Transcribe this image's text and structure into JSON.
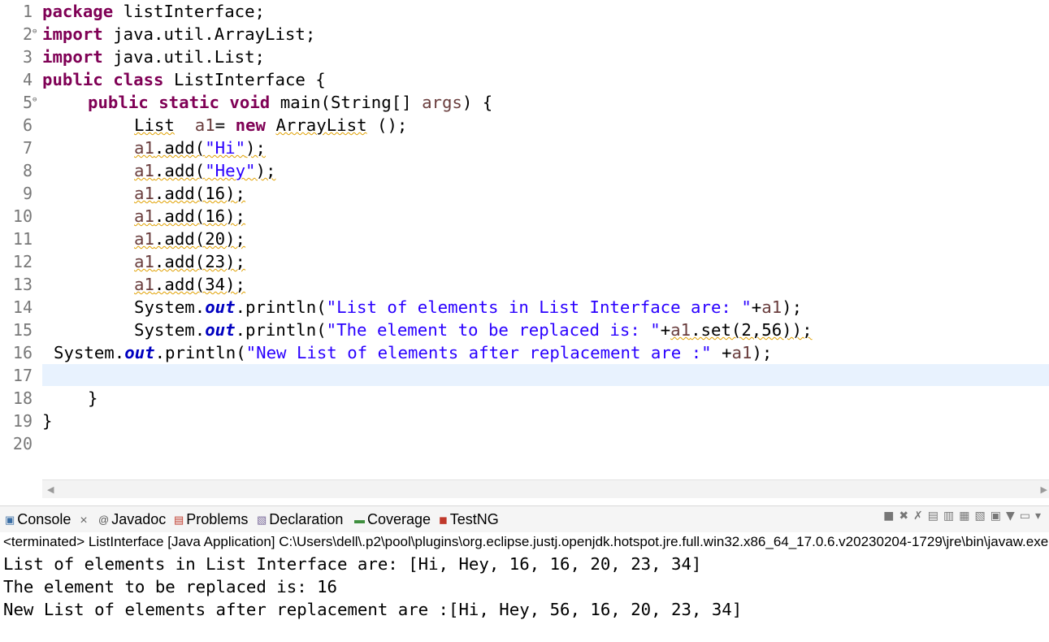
{
  "editor": {
    "line_numbers": [
      "1",
      "2",
      "3",
      "4",
      "5",
      "6",
      "7",
      "8",
      "9",
      "10",
      "11",
      "12",
      "13",
      "14",
      "15",
      "16",
      "17",
      "18",
      "19",
      "20"
    ],
    "code": {
      "l1_kw": "package",
      "l1_rest": " listInterface;",
      "l2_kw": "import",
      "l2_rest": " java.util.ArrayList;",
      "l3_kw": "import",
      "l3_rest": " java.util.List;",
      "l4_kw1": "public",
      "l4_kw2": "class",
      "l4_rest": " ListInterface {",
      "l5_kw1": "public",
      "l5_kw2": "static",
      "l5_kw3": "void",
      "l5_pre": " main(String[] ",
      "l5_var": "args",
      "l5_post": ") {",
      "l6_type": "List",
      "l6_var": "a1",
      "l6_eq": "= ",
      "l6_kw": "new",
      "l6_cls": "ArrayList",
      "l6_post": " ();",
      "l7_var": "a1",
      "l7_call": ".add(",
      "l7_str": "\"Hi\"",
      "l7_end": ");",
      "l8_var": "a1",
      "l8_call": ".add(",
      "l8_str": "\"Hey\"",
      "l8_end": ");",
      "l9_var": "a1",
      "l9_call": ".add(16);",
      "l10_var": "a1",
      "l10_call": ".add(16);",
      "l11_var": "a1",
      "l11_call": ".add(20);",
      "l12_var": "a1",
      "l12_call": ".add(23);",
      "l13_var": "a1",
      "l13_call": ".add(34);",
      "l14_sys": "System.",
      "l14_out": "out",
      "l14_mid": ".println(",
      "l14_str": "\"List of elements in List Interface are: \"",
      "l14_plus": "+",
      "l14_var": "a1",
      "l14_end": ");",
      "l15_sys": "System.",
      "l15_out": "out",
      "l15_mid": ".println(",
      "l15_str": "\"The element to be replaced is: \"",
      "l15_plus": "+",
      "l15_var": "a1",
      "l15_end": ".set(2,56));",
      "l16_sys": "System.",
      "l16_out": "out",
      "l16_mid": ".println(",
      "l16_str": "\"New List of elements after replacement are :\"",
      "l16_plus": " +",
      "l16_var": "a1",
      "l16_end": ");",
      "l18": "}",
      "l19": "}"
    }
  },
  "panel": {
    "tabs": [
      {
        "label": "Console",
        "icon": "console-icon"
      },
      {
        "label": "Javadoc",
        "icon": "javadoc-icon"
      },
      {
        "label": "Problems",
        "icon": "problems-icon"
      },
      {
        "label": "Declaration",
        "icon": "declaration-icon"
      },
      {
        "label": "Coverage",
        "icon": "coverage-icon"
      },
      {
        "label": "TestNG",
        "icon": "testng-icon"
      }
    ],
    "close_glyph": "×",
    "status": "<terminated> ListInterface [Java Application] C:\\Users\\dell\\.p2\\pool\\plugins\\org.eclipse.justj.openjdk.hotspot.jre.full.win32.x86_64_17.0.6.v20230204-1729\\jre\\bin\\javaw.exe",
    "output": [
      "List of elements in List Interface are: [Hi, Hey, 16, 16, 20, 23, 34]",
      "The element to be replaced is: 16",
      "New List of elements after replacement are :[Hi, Hey, 56, 16, 20, 23, 34]"
    ]
  },
  "colors": {
    "keyword": "#7f0055",
    "string": "#2a00ff",
    "field": "#0000c0",
    "local_var": "#6a3e3e",
    "current_line": "#e8f2fe",
    "ruler": "#5b9bd5"
  }
}
